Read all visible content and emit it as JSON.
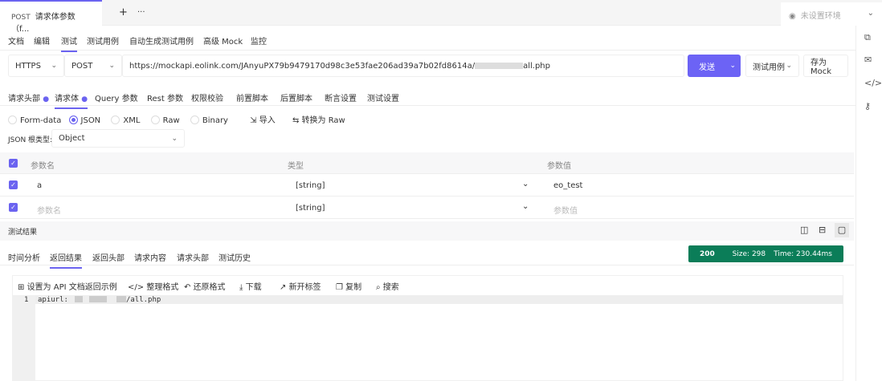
{
  "tabbar": {
    "method": "POST",
    "title": "请求体参数（f...",
    "add": "+",
    "more": "···",
    "env": "未设置环境"
  },
  "nav": [
    "文档",
    "编辑",
    "测试",
    "测试用例",
    "自动生成测试用例",
    "高级 Mock",
    "监控"
  ],
  "request": {
    "protocol": "HTTPS",
    "method": "POST",
    "url": "https://mockapi.eolink.com/JAnyuPX79b9479170d98c3e53fae206ad39a7b02fd8614a/",
    "url_tail": "all.php",
    "send": "发送",
    "test_case": "测试用例",
    "save_mock": "存为 Mock"
  },
  "subtabs": [
    "请求头部",
    "请求体",
    "Query 参数",
    "Rest 参数",
    "权限校验",
    "前置脚本",
    "后置脚本",
    "断言设置",
    "测试设置"
  ],
  "body_types": [
    "Form-data",
    "JSON",
    "XML",
    "Raw",
    "Binary"
  ],
  "import": "导入",
  "to_raw": "转换为 Raw",
  "root_type": {
    "label": "JSON 根类型:",
    "value": "Object"
  },
  "table": {
    "headers": [
      "参数名",
      "类型",
      "参数值"
    ],
    "rows": [
      {
        "name": "a",
        "type": "[string]",
        "value": "eo_test"
      }
    ],
    "new_row": {
      "name": "参数名",
      "type": "[string]",
      "value": "参数值"
    }
  },
  "result": {
    "title": "测试结果",
    "tabs": [
      "时间分析",
      "返回结果",
      "返回头部",
      "请求内容",
      "请求头部",
      "测试历史"
    ],
    "status": "200",
    "size": "Size:  298",
    "time": "Time:  230.44ms"
  },
  "toolbar": [
    "设置为 API 文档返回示例",
    "整理格式",
    "还原格式",
    "下载",
    "新开标签",
    "复制",
    "搜索"
  ],
  "code": {
    "line": "1",
    "prefix": "apiurl:",
    "suffix": "/all.php"
  },
  "colors": {
    "accent": "#6c63f5",
    "status": "#0b7d58"
  }
}
